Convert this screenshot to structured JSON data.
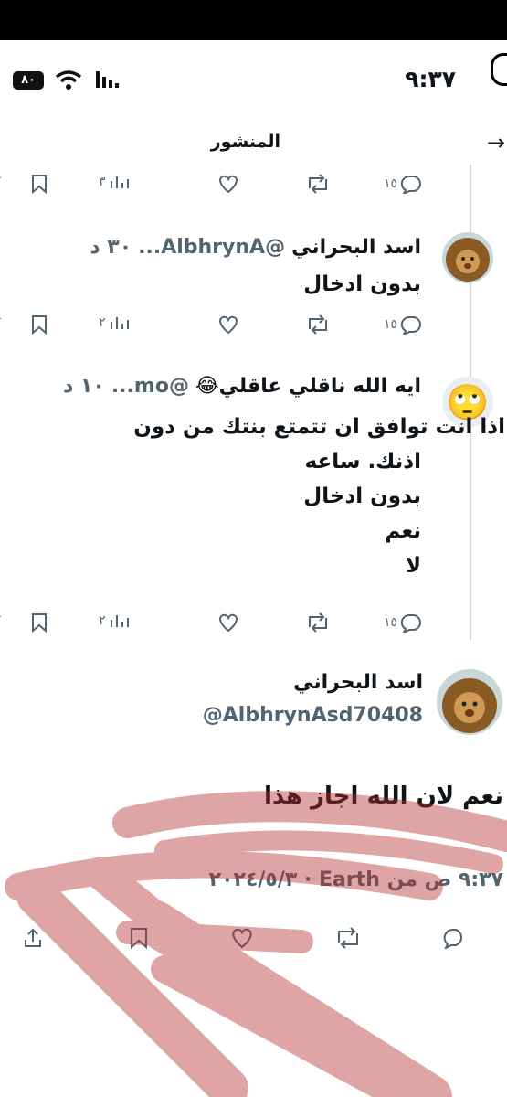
{
  "status_bar": {
    "time": "٩:٣٧",
    "battery": "٨٠"
  },
  "header": {
    "title": "المنشور"
  },
  "replies": [
    {
      "name": "",
      "handle": "",
      "time": "",
      "body": [],
      "stats": {
        "replies": "١٥",
        "views": "٣"
      }
    },
    {
      "name": "اسد البحراني",
      "handle": "@AlbhrynA...",
      "time": "٣٠ د",
      "body": [
        "بدون ادخال"
      ],
      "stats": {
        "replies": "١٥",
        "views": "٢"
      }
    },
    {
      "name": "ايه الله ناقلي عاقلي😂",
      "handle": "@mo...",
      "time": "١٠ د",
      "body": [
        "اذا انت توافق ان تتمتع بنتك من دون",
        "اذنك. ساعه",
        "بدون ادخال",
        "نعم",
        "لا"
      ],
      "stats": {
        "replies": "١٥",
        "views": "٢"
      }
    }
  ],
  "main_post": {
    "name": "اسد البحراني",
    "handle": "@AlbhrynAsd70408",
    "text": "نعم لان الله اجاز هذا",
    "meta": "٩:٣٧ ص من Earth · ٢٠٢٤/٥/٣"
  },
  "avatar_emoji": "🙄",
  "colors": {
    "text": "#0f1419",
    "muted": "#536471",
    "scribble": "#b52c2c"
  }
}
